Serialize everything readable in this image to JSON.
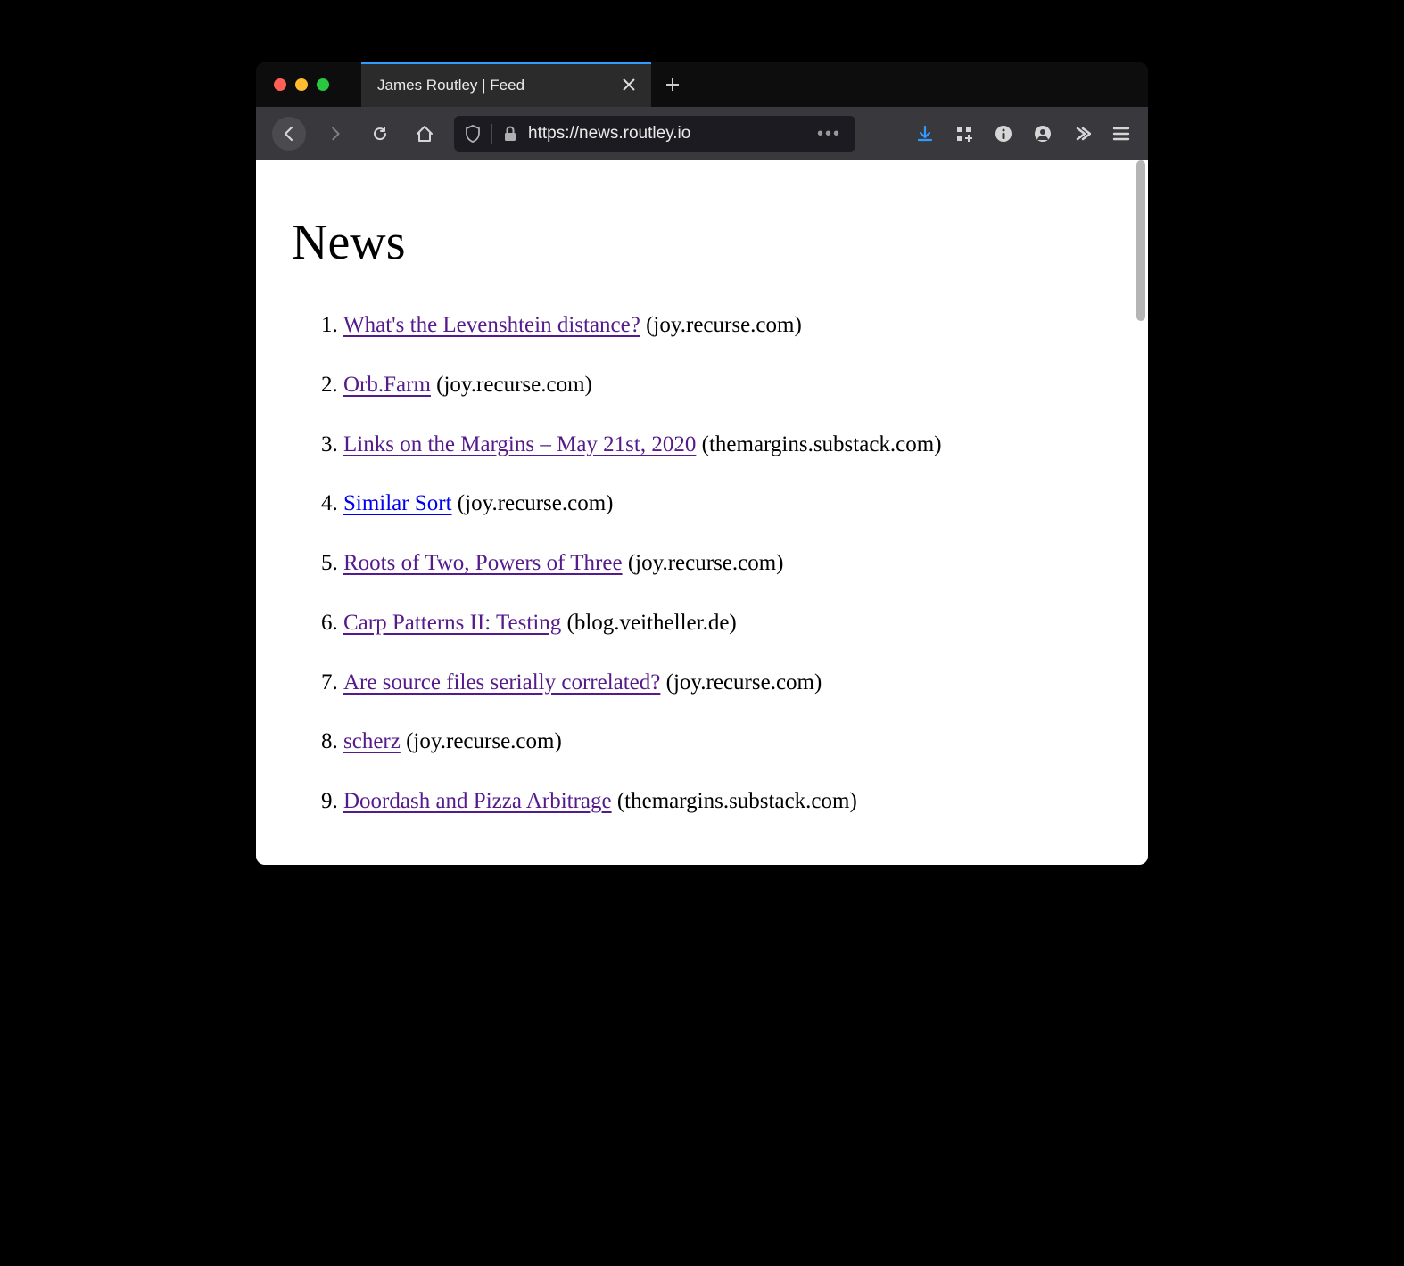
{
  "tab": {
    "title": "James Routley | Feed"
  },
  "url": "https://news.routley.io",
  "page": {
    "heading": "News",
    "items": [
      {
        "title": "What's the Levenshtein distance?",
        "domain": "joy.recurse.com",
        "visited": true
      },
      {
        "title": "Orb.Farm",
        "domain": "joy.recurse.com",
        "visited": true
      },
      {
        "title": "Links on the Margins – May 21st, 2020",
        "domain": "themargins.substack.com",
        "visited": true
      },
      {
        "title": "Similar Sort",
        "domain": "joy.recurse.com",
        "visited": false
      },
      {
        "title": "Roots of Two, Powers of Three",
        "domain": "joy.recurse.com",
        "visited": true
      },
      {
        "title": "Carp Patterns II: Testing",
        "domain": "blog.veitheller.de",
        "visited": true
      },
      {
        "title": "Are source files serially correlated?",
        "domain": "joy.recurse.com",
        "visited": true
      },
      {
        "title": "scherz",
        "domain": "joy.recurse.com",
        "visited": true
      },
      {
        "title": "Doordash and Pizza Arbitrage",
        "domain": "themargins.substack.com",
        "visited": true
      }
    ]
  }
}
